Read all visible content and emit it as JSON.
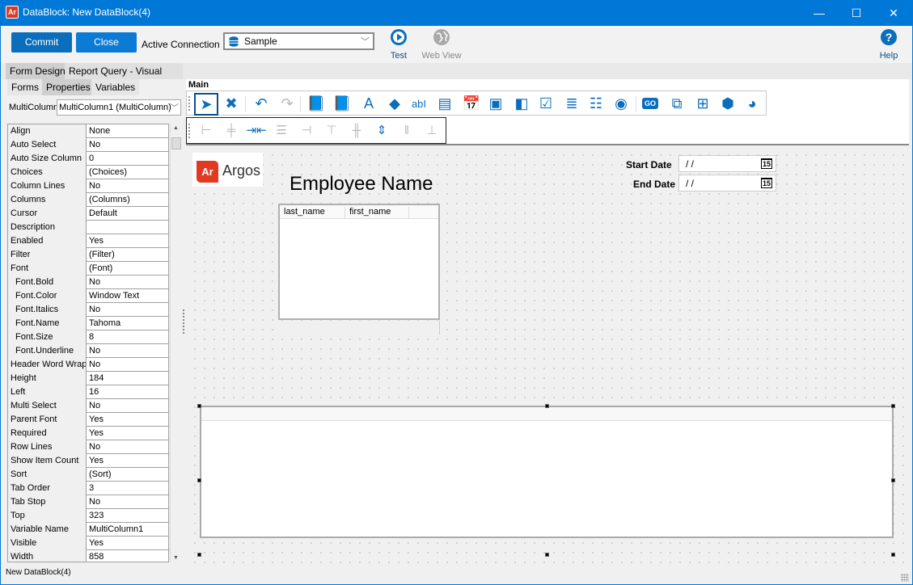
{
  "window": {
    "app_icon": "Ar",
    "title": "DataBlock: New DataBlock(4)",
    "controls": {
      "minimize": "—",
      "maximize": "☐",
      "close": "✕"
    }
  },
  "toolbar": {
    "commit_label": "Commit",
    "close_label": "Close",
    "active_connection_label": "Active Connection",
    "connection_value": "Sample",
    "test_label": "Test",
    "webview_label": "Web View",
    "help_label": "Help"
  },
  "tabs": [
    {
      "label": "Form Design",
      "active": true
    },
    {
      "label": "Report Query - Visual Design",
      "active": false
    }
  ],
  "left_panel": {
    "subtabs": [
      {
        "label": "Forms",
        "active": false
      },
      {
        "label": "Properties",
        "active": true
      },
      {
        "label": "Variables",
        "active": false
      }
    ],
    "object_type_label": "MultiColumn",
    "object_selected": "MultiColumn1 (MultiColumn)",
    "properties": [
      {
        "name": "Align",
        "value": "None"
      },
      {
        "name": "Auto Select",
        "value": "No"
      },
      {
        "name": "Auto Size Column",
        "value": "0"
      },
      {
        "name": "Choices",
        "value": "(Choices)"
      },
      {
        "name": "Column Lines",
        "value": "No"
      },
      {
        "name": "Columns",
        "value": "(Columns)"
      },
      {
        "name": "Cursor",
        "value": "Default"
      },
      {
        "name": "Description",
        "value": ""
      },
      {
        "name": "Enabled",
        "value": "Yes"
      },
      {
        "name": "Filter",
        "value": "(Filter)"
      },
      {
        "name": "Font",
        "value": "(Font)"
      },
      {
        "name": "Font.Bold",
        "value": "No",
        "sub": true
      },
      {
        "name": "Font.Color",
        "value": "Window Text",
        "sub": true
      },
      {
        "name": "Font.Italics",
        "value": "No",
        "sub": true
      },
      {
        "name": "Font.Name",
        "value": "Tahoma",
        "sub": true
      },
      {
        "name": "Font.Size",
        "value": "8",
        "sub": true
      },
      {
        "name": "Font.Underline",
        "value": "No",
        "sub": true
      },
      {
        "name": "Header Word Wrap",
        "value": "No"
      },
      {
        "name": "Height",
        "value": "184"
      },
      {
        "name": "Left",
        "value": "16"
      },
      {
        "name": "Multi Select",
        "value": "No"
      },
      {
        "name": "Parent Font",
        "value": "Yes"
      },
      {
        "name": "Required",
        "value": "Yes"
      },
      {
        "name": "Row Lines",
        "value": "No"
      },
      {
        "name": "Show Item Count",
        "value": "Yes"
      },
      {
        "name": "Sort",
        "value": "(Sort)"
      },
      {
        "name": "Tab Order",
        "value": "3"
      },
      {
        "name": "Tab Stop",
        "value": "No"
      },
      {
        "name": "Top",
        "value": "323"
      },
      {
        "name": "Variable Name",
        "value": "MultiColumn1"
      },
      {
        "name": "Visible",
        "value": "Yes"
      },
      {
        "name": "Width",
        "value": "858"
      }
    ]
  },
  "designer": {
    "toolbar_title": "Main",
    "tools_row1": [
      {
        "name": "pointer-tool",
        "glyph": "➤",
        "active": true
      },
      {
        "name": "delete-tool",
        "glyph": "✖"
      },
      {
        "name": "undo-tool",
        "glyph": "↶"
      },
      {
        "name": "redo-tool",
        "glyph": "↷",
        "disabled": true
      },
      {
        "name": "new-form-tool",
        "glyph": "📘"
      },
      {
        "name": "form-tool",
        "glyph": "📘"
      },
      {
        "name": "label-tool",
        "glyph": "A"
      },
      {
        "name": "shapes-tool",
        "glyph": "◆"
      },
      {
        "name": "textbox-tool",
        "glyph": "abI"
      },
      {
        "name": "memo-tool",
        "glyph": "▤"
      },
      {
        "name": "date-tool",
        "glyph": "📅"
      },
      {
        "name": "image-tool",
        "glyph": "▣"
      },
      {
        "name": "dropdown-tool",
        "glyph": "◧"
      },
      {
        "name": "checkbox-tool",
        "glyph": "☑"
      },
      {
        "name": "listbox-tool",
        "glyph": "≣"
      },
      {
        "name": "multicolumn-tool",
        "glyph": "☷"
      },
      {
        "name": "radio-tool",
        "glyph": "◉"
      },
      {
        "name": "button-tool",
        "glyph": "GO"
      },
      {
        "name": "group-tool",
        "glyph": "⧉"
      },
      {
        "name": "panel-tool",
        "glyph": "⊞"
      },
      {
        "name": "cube-tool",
        "glyph": "⬢"
      },
      {
        "name": "chart-tool",
        "glyph": "◕"
      }
    ],
    "tools_row2": [
      {
        "name": "align-left-tool",
        "glyph": "⊢"
      },
      {
        "name": "align-center-tool",
        "glyph": "╪"
      },
      {
        "name": "center-horizontal-tool",
        "glyph": "⇥⇤",
        "enabled": true
      },
      {
        "name": "same-width-tool",
        "glyph": "☰"
      },
      {
        "name": "align-right-tool",
        "glyph": "⊣"
      },
      {
        "name": "align-top-tool",
        "glyph": "⊤"
      },
      {
        "name": "align-middle-tool",
        "glyph": "╫"
      },
      {
        "name": "center-vertical-tool",
        "glyph": "⇕",
        "enabled": true
      },
      {
        "name": "same-height-tool",
        "glyph": "‖"
      },
      {
        "name": "align-bottom-tool",
        "glyph": "⊥"
      }
    ],
    "form": {
      "logo_mark": "Ar",
      "logo_text": "Argos",
      "heading": "Employee Name",
      "columns": [
        "last_name",
        "first_name"
      ],
      "start_date_label": "Start Date",
      "start_date_value": "/ /",
      "end_date_label": "End Date",
      "end_date_value": "/ /",
      "calendar_glyph": "15"
    }
  },
  "status_bar": {
    "text": "New DataBlock(4)"
  }
}
